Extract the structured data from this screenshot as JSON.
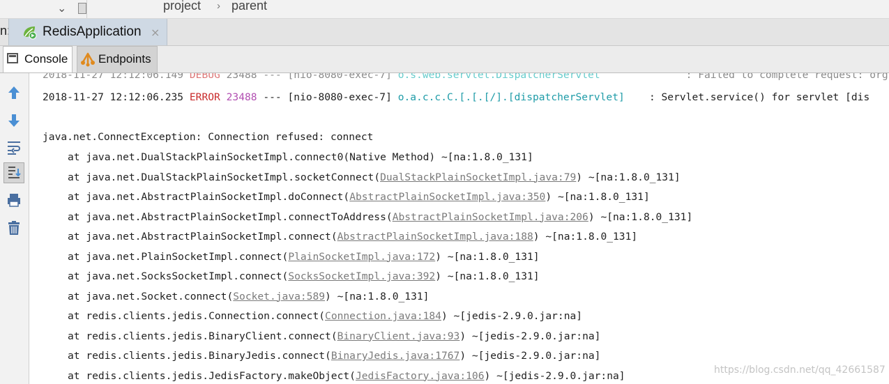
{
  "breadcrumb": {
    "items": [
      "project",
      "parent"
    ],
    "separator": "›"
  },
  "run_bar": {
    "label": "n:",
    "tab_title": "RedisApplication",
    "close_glyph": "×"
  },
  "toolbar": {
    "tabs": [
      {
        "label": "Console",
        "icon": "console-icon",
        "active": true
      },
      {
        "label": "Endpoints",
        "icon": "endpoints-icon",
        "active": false
      }
    ]
  },
  "gutter_icons": [
    "arrow-up-icon",
    "arrow-down-icon",
    "soft-wrap-icon",
    "scroll-to-end-icon",
    "print-icon",
    "trash-icon"
  ],
  "console": {
    "partial_line": {
      "date": "2018-11-27 12:12:06.149",
      "level": "DEBUG",
      "pid": "23488",
      "dashes": "---",
      "thread": "[nio-8080-exec-7]",
      "logger": "o.s.web.servlet.DispatcherServlet",
      "message": ": Failed to complete request: org.sp"
    },
    "error_line": {
      "date": "2018-11-27 12:12:06.235",
      "level": "ERROR",
      "pid": "23488",
      "dashes": "---",
      "thread": "[nio-8080-exec-7]",
      "logger": "o.a.c.c.C.[.[.[/].[dispatcherServlet]",
      "message": ": Servlet.service() for servlet [dis"
    },
    "exception": "java.net.ConnectException: Connection refused: connect",
    "stack": [
      {
        "method": "at java.net.DualStackPlainSocketImpl.connect0(Native Method)",
        "location": "",
        "suffix": " ~[na:1.8.0_131]"
      },
      {
        "method": "at java.net.DualStackPlainSocketImpl.socketConnect",
        "location": "DualStackPlainSocketImpl.java:79",
        "suffix": " ~[na:1.8.0_131]"
      },
      {
        "method": "at java.net.AbstractPlainSocketImpl.doConnect",
        "location": "AbstractPlainSocketImpl.java:350",
        "suffix": " ~[na:1.8.0_131]"
      },
      {
        "method": "at java.net.AbstractPlainSocketImpl.connectToAddress",
        "location": "AbstractPlainSocketImpl.java:206",
        "suffix": " ~[na:1.8.0_131]"
      },
      {
        "method": "at java.net.AbstractPlainSocketImpl.connect",
        "location": "AbstractPlainSocketImpl.java:188",
        "suffix": " ~[na:1.8.0_131]"
      },
      {
        "method": "at java.net.PlainSocketImpl.connect",
        "location": "PlainSocketImpl.java:172",
        "suffix": " ~[na:1.8.0_131]"
      },
      {
        "method": "at java.net.SocksSocketImpl.connect",
        "location": "SocksSocketImpl.java:392",
        "suffix": " ~[na:1.8.0_131]"
      },
      {
        "method": "at java.net.Socket.connect",
        "location": "Socket.java:589",
        "suffix": " ~[na:1.8.0_131]"
      },
      {
        "method": "at redis.clients.jedis.Connection.connect",
        "location": "Connection.java:184",
        "suffix": " ~[jedis-2.9.0.jar:na]"
      },
      {
        "method": "at redis.clients.jedis.BinaryClient.connect",
        "location": "BinaryClient.java:93",
        "suffix": " ~[jedis-2.9.0.jar:na]"
      },
      {
        "method": "at redis.clients.jedis.BinaryJedis.connect",
        "location": "BinaryJedis.java:1767",
        "suffix": " ~[jedis-2.9.0.jar:na]"
      },
      {
        "method": "at redis.clients.jedis.JedisFactory.makeObject",
        "location": "JedisFactory.java:106",
        "suffix": " ~[jedis-2.9.0.jar:na]"
      }
    ]
  },
  "watermark": "https://blog.csdn.net/qq_42661587",
  "colors": {
    "error": "#c92d2d",
    "pid": "#b24fb2",
    "logger": "#1f9ca8",
    "link": "#7a7a7a",
    "tab_active": "#cfd9e4"
  }
}
